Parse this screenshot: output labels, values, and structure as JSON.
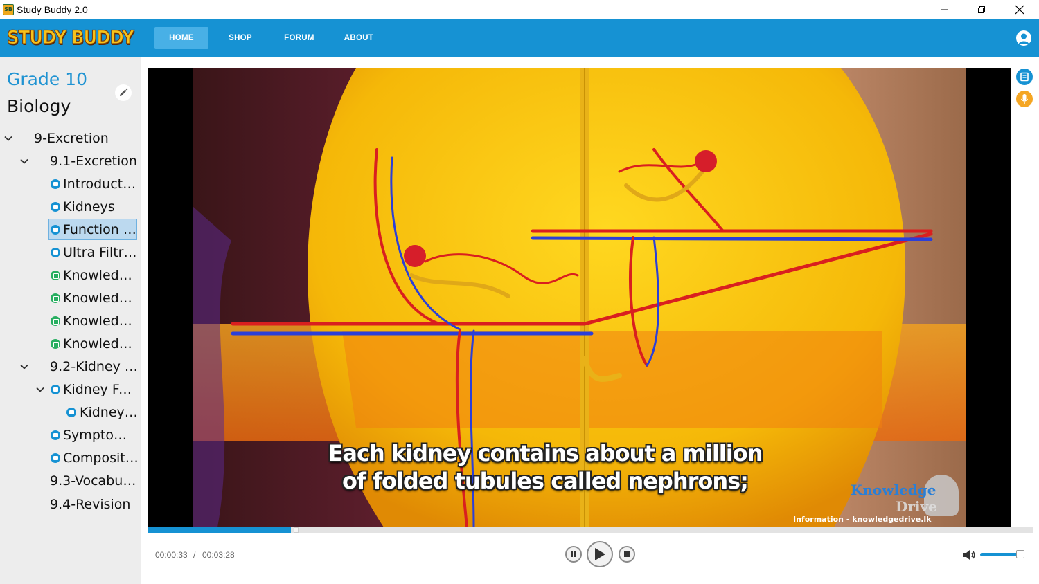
{
  "window": {
    "title": "Study Buddy 2.0",
    "icon_text": "SB"
  },
  "brand": {
    "logo_text": "STUDY BUDDY"
  },
  "nav": {
    "items": [
      {
        "label": "HOME",
        "active": true
      },
      {
        "label": "SHOP"
      },
      {
        "label": "FORUM"
      },
      {
        "label": "ABOUT"
      }
    ]
  },
  "sidebar": {
    "grade": "Grade 10",
    "subject": "Biology",
    "tree": [
      {
        "label": "9-Excretion"
      },
      {
        "label": "9.1-Excretion"
      },
      {
        "label": "Introduction",
        "icon": "video"
      },
      {
        "label": "Kidneys",
        "icon": "video"
      },
      {
        "label": "Function o...",
        "icon": "video",
        "selected": true
      },
      {
        "label": "Ultra Filtra...",
        "icon": "video"
      },
      {
        "label": "Knowledg...",
        "icon": "quiz"
      },
      {
        "label": "Knowledg...",
        "icon": "quiz"
      },
      {
        "label": "Knowledg...",
        "icon": "quiz"
      },
      {
        "label": "Knowledg...",
        "icon": "quiz"
      },
      {
        "label": "9.2-Kidney F..."
      },
      {
        "label": "Kidney Fail...",
        "icon": "video"
      },
      {
        "label": "Kidney ...",
        "icon": "video"
      },
      {
        "label": "Symptoms...",
        "icon": "video"
      },
      {
        "label": "Compositi...",
        "icon": "video"
      },
      {
        "label": "9.3-Vocabula..."
      },
      {
        "label": "9.4-Revision"
      }
    ]
  },
  "video": {
    "subtitle_line1": "Each kidney contains about a million",
    "subtitle_line2": "of folded tubules called nephrons;",
    "watermark_brand_1": "Knowledge",
    "watermark_brand_2": "Drive",
    "watermark_url": "Information - knowledgedrive.lk",
    "progress": 0.161
  },
  "player": {
    "current_time": "00:00:33",
    "separator": "/",
    "total_time": "00:03:28",
    "volume": 0.9
  },
  "colors": {
    "accent": "#1692d3",
    "logo": "#f7c21a",
    "quiz": "#27ae60",
    "mic": "#f5a623"
  }
}
